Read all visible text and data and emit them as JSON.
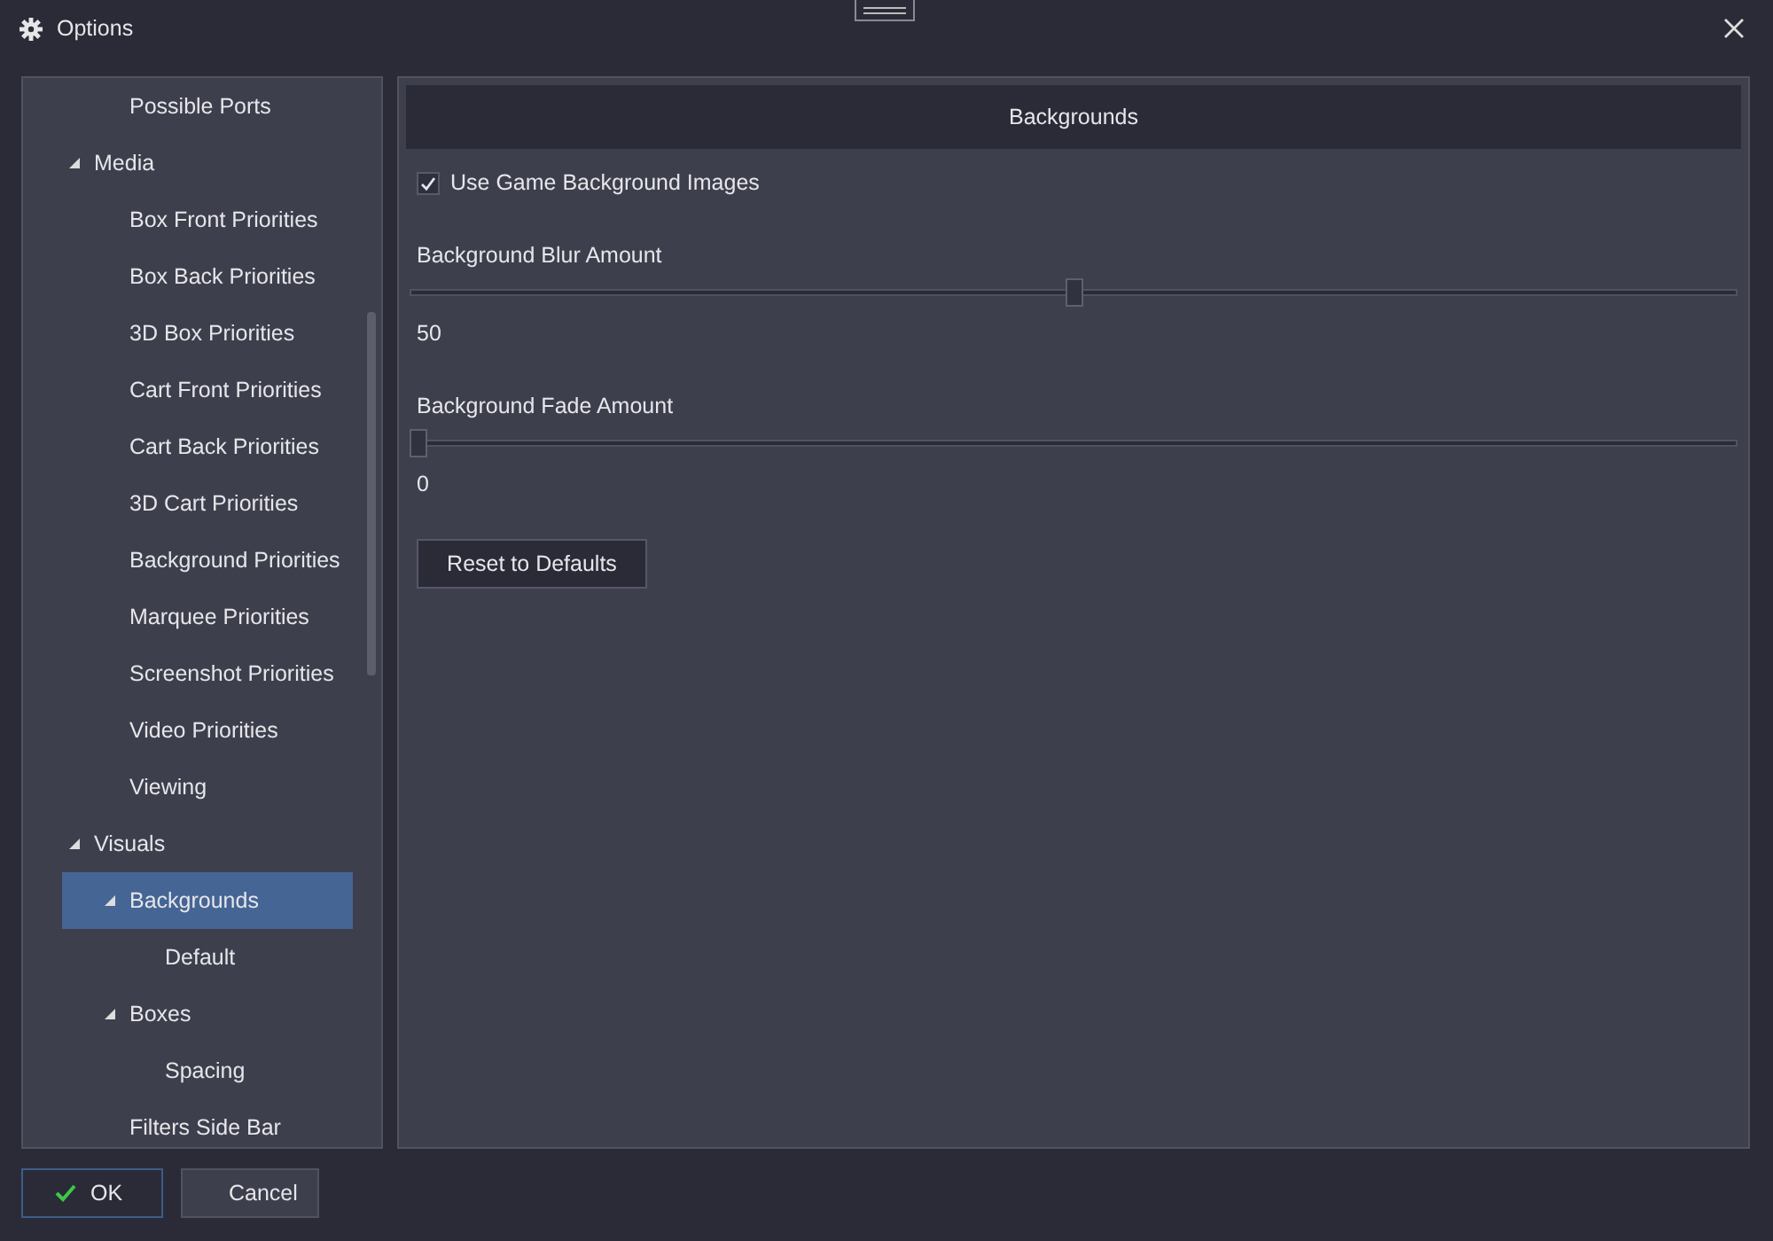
{
  "window": {
    "title": "Options"
  },
  "tree": [
    {
      "children": [
        {
          "label": "Possible Ports",
          "selected": false
        }
      ]
    },
    {
      "label": "Media",
      "expanded": true,
      "selected": false,
      "children": [
        {
          "label": "Box Front Priorities",
          "selected": false
        },
        {
          "label": "Box Back Priorities",
          "selected": false
        },
        {
          "label": "3D Box Priorities",
          "selected": false
        },
        {
          "label": "Cart Front Priorities",
          "selected": false
        },
        {
          "label": "Cart Back Priorities",
          "selected": false
        },
        {
          "label": "3D Cart Priorities",
          "selected": false
        },
        {
          "label": "Background Priorities",
          "selected": false
        },
        {
          "label": "Marquee Priorities",
          "selected": false
        },
        {
          "label": "Screenshot Priorities",
          "selected": false
        },
        {
          "label": "Video Priorities",
          "selected": false
        },
        {
          "label": "Viewing",
          "selected": false
        }
      ]
    },
    {
      "label": "Visuals",
      "expanded": true,
      "selected": false,
      "children": [
        {
          "label": "Backgrounds",
          "expanded": true,
          "selected": true,
          "children": [
            {
              "label": "Default",
              "selected": false
            }
          ]
        },
        {
          "label": "Boxes",
          "expanded": true,
          "selected": false,
          "children": [
            {
              "label": "Spacing",
              "selected": false
            }
          ]
        },
        {
          "label": "Filters Side Bar",
          "selected": false
        }
      ]
    }
  ],
  "panel": {
    "title": "Backgrounds",
    "checkbox": {
      "label": "Use Game Background Images",
      "checked": true
    },
    "sliders": [
      {
        "label": "Background Blur Amount",
        "level": 0.5,
        "reading": "50"
      },
      {
        "label": "Background Fade Amount",
        "level": 0,
        "reading": "0"
      }
    ],
    "reset_button": "Reset to Defaults"
  },
  "buttons": [
    {
      "kind": "ok",
      "label": "OK"
    },
    {
      "kind": "cancel",
      "label": "Cancel"
    }
  ]
}
